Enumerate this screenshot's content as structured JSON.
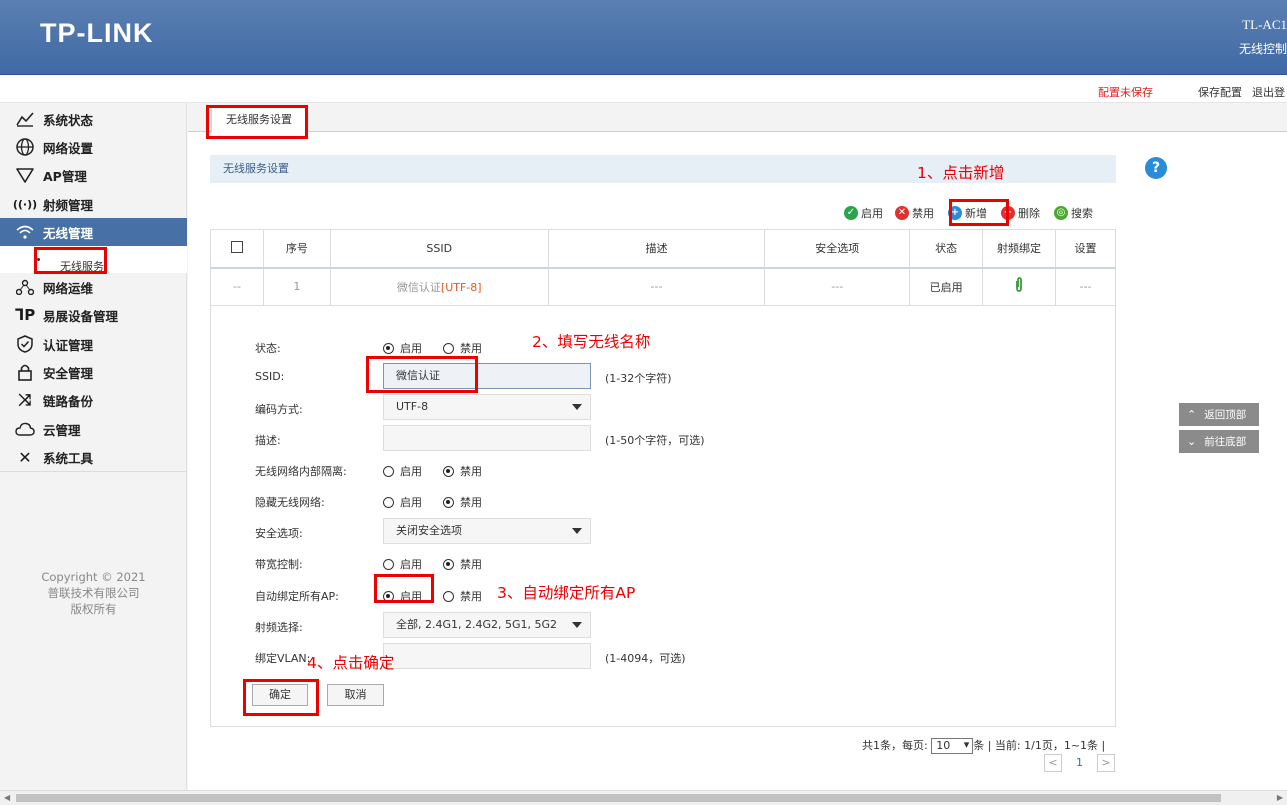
{
  "header": {
    "logo": "TP-LINK",
    "model": "TL-AC1",
    "subtitle": "无线控制"
  },
  "topbar": {
    "unsaved": "配置未保存",
    "save": "保存配置",
    "logout": "退出登"
  },
  "sidebar": {
    "items": [
      {
        "label": "系统状态",
        "icon": "chart-line-icon"
      },
      {
        "label": "网络设置",
        "icon": "globe-icon"
      },
      {
        "label": "AP管理",
        "icon": "ap-icon"
      },
      {
        "label": "射频管理",
        "icon": "radio-wave-icon"
      },
      {
        "label": "无线管理",
        "icon": "wifi-icon"
      },
      {
        "label": "网络运维",
        "icon": "network-ops-icon"
      },
      {
        "label": "易展设备管理",
        "icon": "easy-expand-icon"
      },
      {
        "label": "认证管理",
        "icon": "shield-check-icon"
      },
      {
        "label": "安全管理",
        "icon": "lock-icon"
      },
      {
        "label": "链路备份",
        "icon": "shuffle-icon"
      },
      {
        "label": "云管理",
        "icon": "cloud-icon"
      },
      {
        "label": "系统工具",
        "icon": "tools-icon"
      }
    ],
    "sub_item": "无线服务",
    "copyright": [
      "Copyright © 2021",
      "普联技术有限公司",
      "版权所有"
    ]
  },
  "tab": "无线服务设置",
  "panel_title": "无线服务设置",
  "toolbar": {
    "enable": "启用",
    "disable": "禁用",
    "add": "新增",
    "delete": "删除",
    "search": "搜索"
  },
  "table": {
    "columns": [
      "序号",
      "SSID",
      "描述",
      "安全选项",
      "状态",
      "射频绑定",
      "设置"
    ],
    "row": {
      "checkbox": "--",
      "index": "1",
      "ssid": "微信认证",
      "encoding": "[UTF-8]",
      "desc": "---",
      "security": "---",
      "state": "已启用",
      "settings": "---"
    }
  },
  "form": {
    "state": {
      "label": "状态:",
      "on": "启用",
      "off": "禁用",
      "value": "启用"
    },
    "ssid": {
      "label": "SSID:",
      "value": "微信认证",
      "hint": "(1-32个字符)"
    },
    "encoding": {
      "label": "编码方式:",
      "value": "UTF-8"
    },
    "desc": {
      "label": "描述:",
      "value": "",
      "hint": "(1-50个字符，可选)"
    },
    "isolation": {
      "label": "无线网络内部隔离:",
      "on": "启用",
      "off": "禁用",
      "value": "禁用"
    },
    "hide": {
      "label": "隐藏无线网络:",
      "on": "启用",
      "off": "禁用",
      "value": "禁用"
    },
    "security": {
      "label": "安全选项:",
      "value": "关闭安全选项"
    },
    "bandwidth": {
      "label": "带宽控制:",
      "on": "启用",
      "off": "禁用",
      "value": "禁用"
    },
    "bind_all": {
      "label": "自动绑定所有AP:",
      "on": "启用",
      "off": "禁用",
      "value": "启用"
    },
    "radio": {
      "label": "射频选择:",
      "value": "全部, 2.4G1, 2.4G2, 5G1, 5G2"
    },
    "vlan": {
      "label": "绑定VLAN:",
      "value": "",
      "hint": "(1-4094，可选)"
    },
    "ok": "确定",
    "cancel": "取消"
  },
  "pager": {
    "summary_a": "共1条，每页:",
    "per_page": "10",
    "summary_b": "条 | 当前: 1/1页，1~1条 |",
    "page": "1",
    "prev": "<",
    "next": ">"
  },
  "side_buttons": {
    "top": "返回顶部",
    "bottom": "前往底部"
  },
  "help": "?",
  "annotations": {
    "step1": "1、点击新增",
    "step2": "2、填写无线名称",
    "step3": "3、自动绑定所有AP",
    "step4": "4、点击确定"
  },
  "colors": {
    "header": "#4a74ab",
    "active_nav": "#4770a6",
    "annotation": "#ee0000",
    "enable_icon": "#2aa44a",
    "disable_icon": "#e03030",
    "add_icon": "#2a8cd6"
  }
}
